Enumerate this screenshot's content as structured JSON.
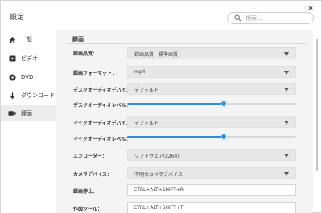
{
  "window": {
    "title": "設定",
    "close": "✕"
  },
  "search": {
    "placeholder": "検索..."
  },
  "sidebar": {
    "items": [
      {
        "label": "一般",
        "icon": "home-icon"
      },
      {
        "label": "ビデオ",
        "icon": "video-icon"
      },
      {
        "label": "DVD",
        "icon": "disc-icon"
      },
      {
        "label": "ダウンロード",
        "icon": "download-icon"
      },
      {
        "label": "録画",
        "icon": "camera-icon",
        "active": true
      }
    ]
  },
  "content": {
    "section_title": "録画",
    "rows": {
      "quality": {
        "label": "録画品質：",
        "value": "録画品質：標準画質"
      },
      "format": {
        "label": "録画フォーマット：",
        "value": "mp4"
      },
      "desktop_device": {
        "label": "デスクオーディオデバイス：",
        "value": "デフォルト"
      },
      "desktop_level": {
        "label": "デスクオーディオレベル：",
        "level": 0.57
      },
      "mic_device": {
        "label": "マイクオーディオデバイス：",
        "value": "デフォルト"
      },
      "mic_level": {
        "label": "マイクオーディオレベル：",
        "level": 0.57
      },
      "encoder": {
        "label": "エンコーダー：",
        "value": "ソフトウェア(x264)"
      },
      "camera": {
        "label": "カメラデバイス：",
        "value": "不明なカメラデバイス"
      },
      "stop_hotkey": {
        "label": "録画停止：",
        "value": "CTRL+ALT+SHIFT+R"
      },
      "tool_hotkey": {
        "label": "作図ツール：",
        "value": "CTRL+ALT+SHIFT+T"
      }
    }
  },
  "colors": {
    "accent": "#2f8fdb",
    "dropdown_bg": "#e7e7e7",
    "content_bg": "#f4f4f4"
  }
}
